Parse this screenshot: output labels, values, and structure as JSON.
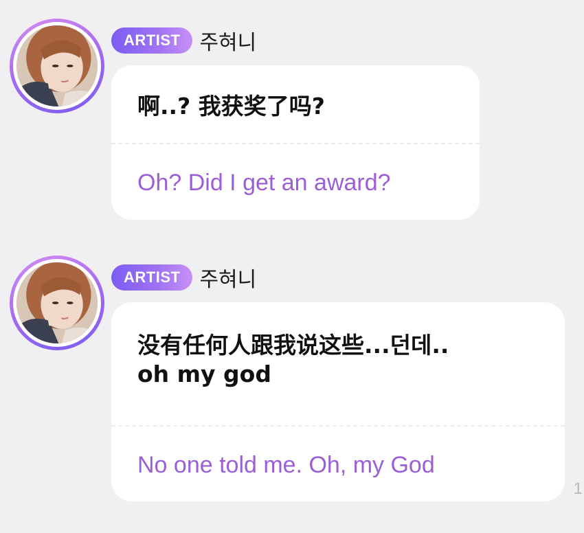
{
  "messages": [
    {
      "badge": "ARTIST",
      "name": "주혀니",
      "original": "啊..? 我获奖了吗?",
      "translation": "Oh? Did I get an award?"
    },
    {
      "badge": "ARTIST",
      "name": "주혀니",
      "original": "没有任何人跟我说这些...던데..\noh my god",
      "translation": "No one told me. Oh, my God"
    }
  ],
  "edge_mark": "1",
  "colors": {
    "background": "#f0f0f2",
    "bubble": "#ffffff",
    "translation_text": "#9a5fd6",
    "badge_gradient_start": "#7b5cf2",
    "badge_gradient_end": "#c690f5"
  },
  "icons": {
    "avatar": "profile-photo"
  }
}
